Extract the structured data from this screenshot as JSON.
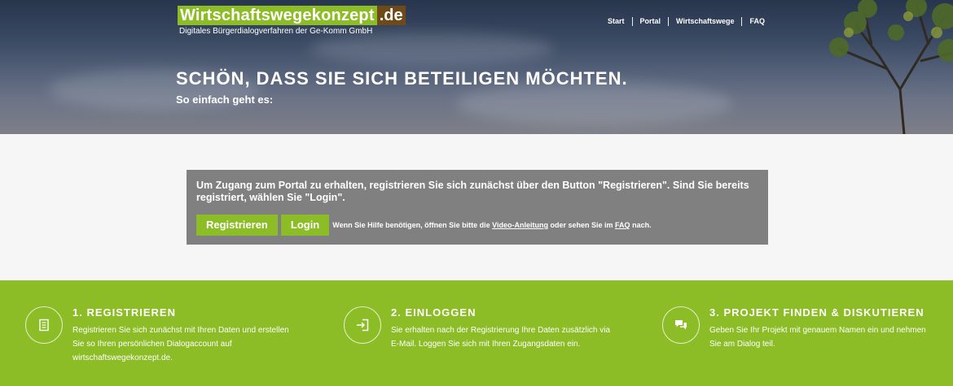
{
  "logo": {
    "main": "Wirtschaftswegekonzept",
    "tld": ".de",
    "subtitle": "Digitales Bürgerdialogverfahren der Ge-Komm GmbH"
  },
  "nav": [
    "Start",
    "Portal",
    "Wirtschaftswege",
    "FAQ"
  ],
  "hero": {
    "title": "SCHÖN, DASS SIE SICH BETEILIGEN MÖCHTEN.",
    "subtitle": "So einfach geht es:"
  },
  "info": {
    "text": "Um Zugang zum Portal zu erhalten, registrieren Sie sich zunächst über den Button \"Registrieren\". Sind Sie bereits registriert, wählen Sie \"Login\".",
    "register_label": "Registrieren",
    "login_label": "Login",
    "help_prefix": "Wenn Sie Hilfe benötigen, öffnen Sie bitte die",
    "video_link": "Video-Anleitung",
    "help_middle": "oder sehen Sie im",
    "faq_link": "FAQ",
    "help_suffix": "nach."
  },
  "steps": [
    {
      "title": "1. REGISTRIEREN",
      "text": "Registrieren Sie sich zunächst mit Ihren Daten und erstellen Sie so Ihren persönlichen Dialogaccount auf wirtschaftswegekonzept.de.",
      "icon": "document-icon"
    },
    {
      "title": "2. EINLOGGEN",
      "text": "Sie erhalten nach der Registrierung Ihre Daten zusätzlich via E-Mail. Loggen Sie sich mit Ihren Zugangsdaten ein.",
      "icon": "login-icon"
    },
    {
      "title": "3. PROJEKT FINDEN & DISKUTIEREN",
      "text": "Geben Sie Ihr Projekt mit genauem Namen ein und nehmen Sie am Dialog teil.",
      "icon": "chat-icon"
    }
  ],
  "colors": {
    "green": "#8cbc26",
    "brown": "#6d4a17",
    "box_gray": "#808080"
  }
}
